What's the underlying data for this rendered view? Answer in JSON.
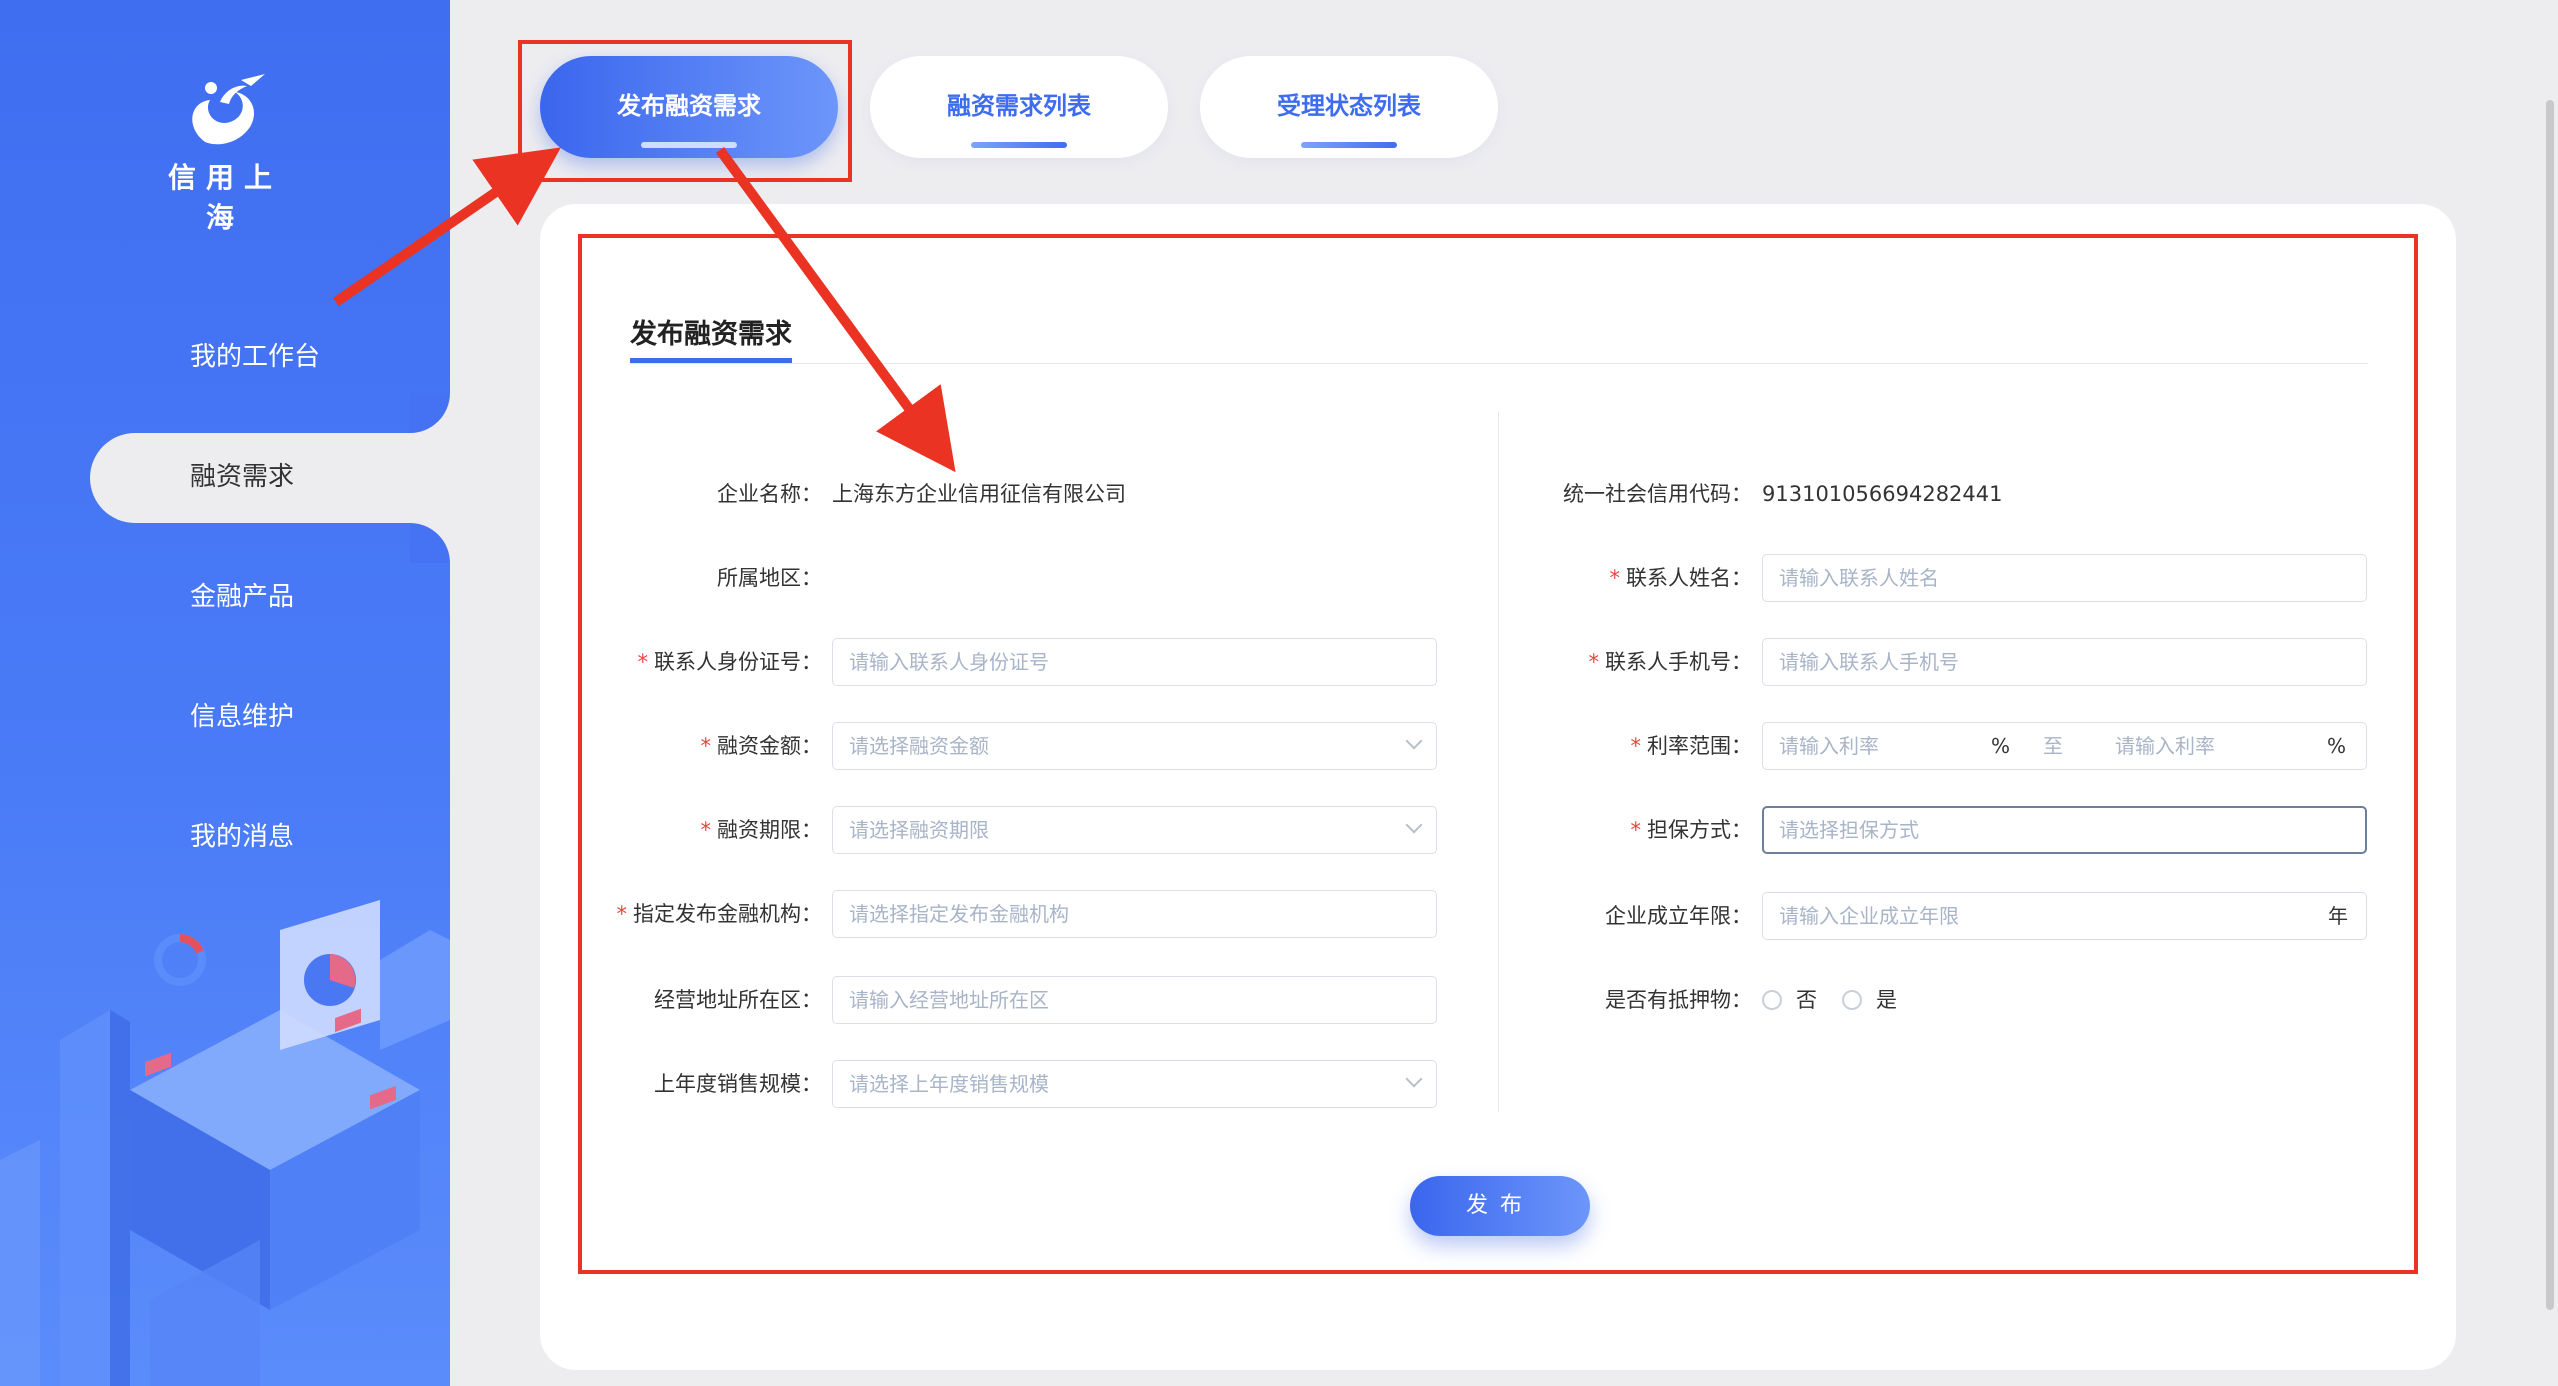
{
  "brand": {
    "logo_text": "信用上海"
  },
  "sidebar": {
    "items": [
      {
        "label": "我的工作台"
      },
      {
        "label": "融资需求"
      },
      {
        "label": "金融产品"
      },
      {
        "label": "信息维护"
      },
      {
        "label": "我的消息"
      }
    ],
    "active_index": 1
  },
  "tabs": [
    {
      "label": "发布融资需求",
      "active": true
    },
    {
      "label": "融资需求列表",
      "active": false
    },
    {
      "label": "受理状态列表",
      "active": false
    }
  ],
  "form": {
    "title": "发布融资需求",
    "left": {
      "company_name": {
        "label": "企业名称：",
        "value": "上海东方企业信用征信有限公司"
      },
      "region": {
        "label": "所属地区：",
        "value": ""
      },
      "id_number": {
        "label": "联系人身份证号：",
        "placeholder": "请输入联系人身份证号",
        "required": true
      },
      "amount": {
        "label": "融资金额：",
        "placeholder": "请选择融资金额",
        "required": true
      },
      "term": {
        "label": "融资期限：",
        "placeholder": "请选择融资期限",
        "required": true
      },
      "institution": {
        "label": "指定发布金融机构：",
        "placeholder": "请选择指定发布金融机构",
        "required": true
      },
      "address_district": {
        "label": "经营地址所在区：",
        "placeholder": "请输入经营地址所在区",
        "required": false
      },
      "sales_scale": {
        "label": "上年度销售规模：",
        "placeholder": "请选择上年度销售规模",
        "required": false
      }
    },
    "right": {
      "credit_code": {
        "label": "统一社会信用代码：",
        "value": "913101056694282441"
      },
      "contact_name": {
        "label": "联系人姓名：",
        "placeholder": "请输入联系人姓名",
        "required": true
      },
      "contact_phone": {
        "label": "联系人手机号：",
        "placeholder": "请输入联系人手机号",
        "required": true
      },
      "rate_range": {
        "label": "利率范围：",
        "placeholder_from": "请输入利率",
        "placeholder_to": "请输入利率",
        "unit": "%",
        "separator": "至",
        "required": true
      },
      "guarantee": {
        "label": "担保方式：",
        "placeholder": "请选择担保方式",
        "required": true
      },
      "years": {
        "label": "企业成立年限：",
        "placeholder": "请输入企业成立年限",
        "unit": "年",
        "required": false
      },
      "collateral": {
        "label": "是否有抵押物：",
        "options": [
          "否",
          "是"
        ],
        "required": false
      }
    },
    "submit_label": "发布"
  },
  "colors": {
    "primary": "#3e6cf0",
    "required": "#e8463e",
    "annotation": "#ea3323"
  }
}
